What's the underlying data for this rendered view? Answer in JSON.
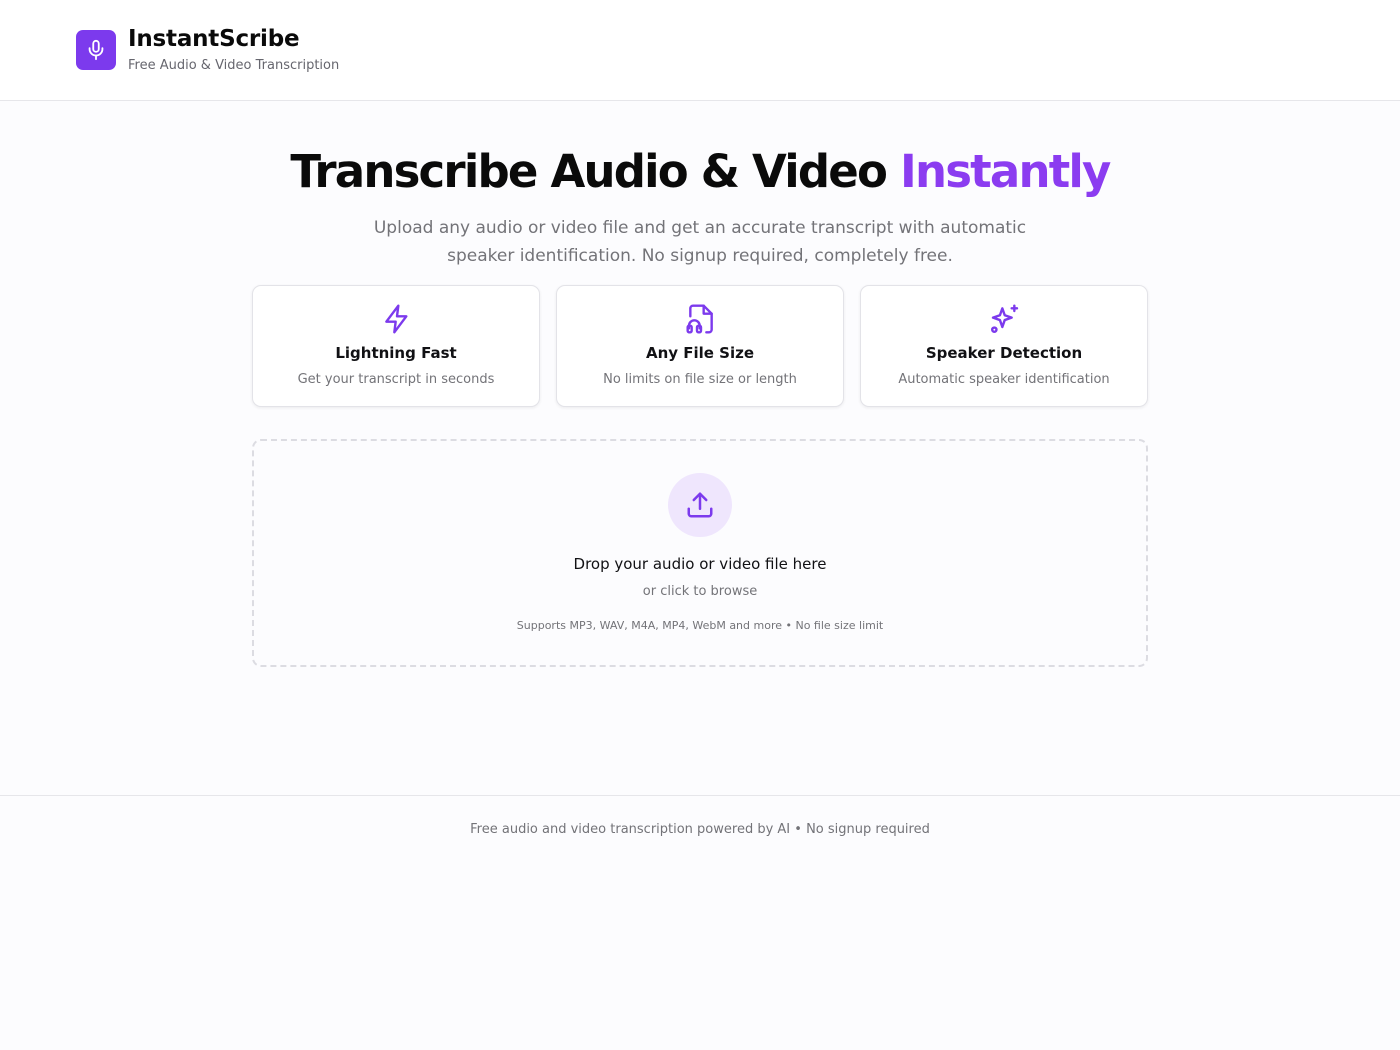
{
  "header": {
    "brand_name": "InstantScribe",
    "brand_subtitle": "Free Audio & Video Transcription",
    "logo_icon": "microphone-icon",
    "accent_color": "#7c3aed"
  },
  "hero": {
    "title_main": "Transcribe Audio & Video ",
    "title_accent": "Instantly",
    "description": "Upload any audio or video file and get an accurate transcript with automatic speaker identification. No signup required, completely free."
  },
  "features": [
    {
      "icon": "lightning-icon",
      "title": "Lightning Fast",
      "description": "Get your transcript in seconds"
    },
    {
      "icon": "file-headphones-icon",
      "title": "Any File Size",
      "description": "No limits on file size or length"
    },
    {
      "icon": "sparkles-icon",
      "title": "Speaker Detection",
      "description": "Automatic speaker identification"
    }
  ],
  "dropzone": {
    "icon": "upload-icon",
    "title": "Drop your audio or video file here",
    "subtitle": "or click to browse",
    "note": "Supports MP3, WAV, M4A, MP4, WebM and more • No file size limit"
  },
  "footer": {
    "text": "Free audio and video transcription powered by AI • No signup required"
  }
}
